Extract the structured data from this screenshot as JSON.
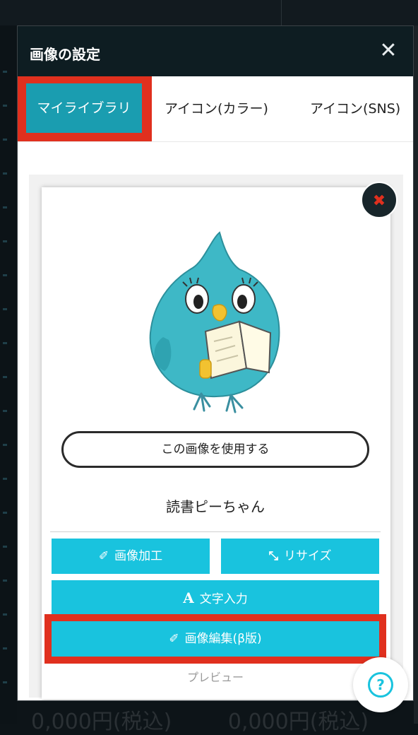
{
  "background": {
    "bottom_text_left": "0,000円(税込)",
    "bottom_text_right": "0,000円(税込)"
  },
  "modal": {
    "title": "画像の設定",
    "close_icon": "close-icon"
  },
  "tabs": [
    {
      "label": "マイライブラリ",
      "active": true
    },
    {
      "label": "アイコン(カラー)",
      "active": false
    },
    {
      "label": "アイコン(SNS)",
      "active": false
    }
  ],
  "card": {
    "delete_icon": "x-icon",
    "use_button": "この画像を使用する",
    "image_name": "読書ピーちゃん",
    "buttons": {
      "process": "画像加工",
      "resize": "リサイズ",
      "text_input": "文字入力",
      "edit_beta": "画像編集(β版)"
    },
    "preview": "プレビュー"
  },
  "help": {
    "icon": "question-icon",
    "glyph": "?"
  },
  "colors": {
    "accent": "#19c3de",
    "tab_active": "#1a9db0",
    "highlight": "#e0301e",
    "header": "#0e1d22"
  }
}
